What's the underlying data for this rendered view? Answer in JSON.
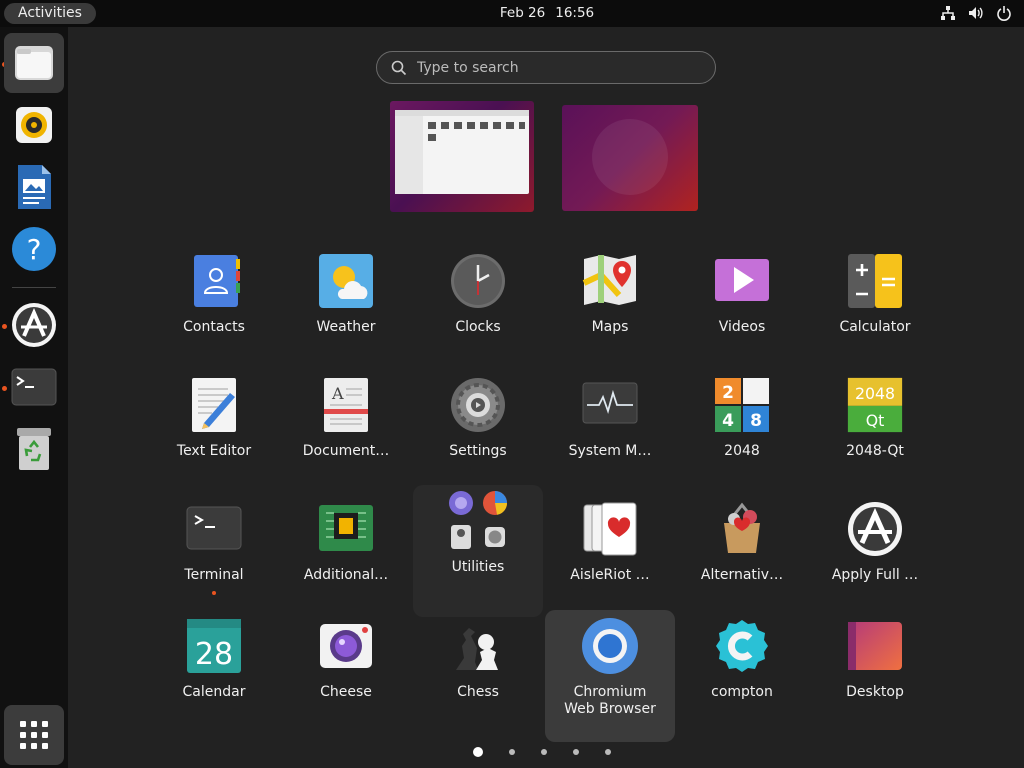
{
  "topbar": {
    "activities": "Activities",
    "date": "Feb 26",
    "time": "16:56",
    "tray": [
      "network-icon",
      "volume-icon",
      "power-icon"
    ]
  },
  "dock": {
    "items": [
      {
        "name": "files",
        "icon": "files-icon",
        "running": true,
        "active": true
      },
      {
        "name": "rhythmbox",
        "icon": "rhythmbox-icon",
        "running": false
      },
      {
        "name": "libreoffice-writer",
        "icon": "writer-icon",
        "running": false
      },
      {
        "name": "help",
        "icon": "help-icon",
        "running": false
      },
      {
        "name": "software-updater",
        "icon": "updater-icon",
        "running": true
      },
      {
        "name": "terminal",
        "icon": "terminal-icon",
        "running": true
      },
      {
        "name": "trash",
        "icon": "trash-icon",
        "running": false
      }
    ],
    "show_apps": "show-applications-icon"
  },
  "search": {
    "placeholder": "Type to search",
    "value": ""
  },
  "apps": [
    {
      "label": "Contacts",
      "icon": "contacts-icon"
    },
    {
      "label": "Weather",
      "icon": "weather-icon"
    },
    {
      "label": "Clocks",
      "icon": "clocks-icon"
    },
    {
      "label": "Maps",
      "icon": "maps-icon"
    },
    {
      "label": "Videos",
      "icon": "videos-icon"
    },
    {
      "label": "Calculator",
      "icon": "calculator-icon"
    },
    {
      "label": "Text Editor",
      "icon": "text-editor-icon"
    },
    {
      "label": "Document…",
      "icon": "document-viewer-icon"
    },
    {
      "label": "Settings",
      "icon": "settings-icon"
    },
    {
      "label": "System M…",
      "icon": "system-monitor-icon"
    },
    {
      "label": "2048",
      "icon": "2048-icon",
      "tiles": [
        "2",
        "4",
        "8"
      ]
    },
    {
      "label": "2048-Qt",
      "icon": "2048-qt-icon",
      "tiles": [
        "2048",
        "Qt"
      ]
    },
    {
      "label": "Terminal",
      "icon": "terminal-icon",
      "running": true
    },
    {
      "label": "Additional…",
      "icon": "additional-drivers-icon"
    },
    {
      "label": "Utilities",
      "icon": "utilities-folder-icon"
    },
    {
      "label": "AisleRiot …",
      "icon": "aisleriot-icon"
    },
    {
      "label": "Alternativ…",
      "icon": "alternative-icon"
    },
    {
      "label": "Apply Full …",
      "icon": "apply-full-upgrade-icon"
    },
    {
      "label": "Calendar",
      "icon": "calendar-icon",
      "day": "28"
    },
    {
      "label": "Cheese",
      "icon": "cheese-icon"
    },
    {
      "label": "Chess",
      "icon": "chess-icon"
    },
    {
      "label": "Chromium Web Browser",
      "icon": "chromium-icon",
      "selected": true
    },
    {
      "label": "compton",
      "icon": "compton-icon"
    },
    {
      "label": "Desktop",
      "icon": "desktop-icon"
    }
  ],
  "pager": {
    "pages": 5,
    "current": 1
  },
  "colors": {
    "accent": "#e95420",
    "panel": "#0c0c0c",
    "dock": "#111111",
    "background": "#222222"
  }
}
